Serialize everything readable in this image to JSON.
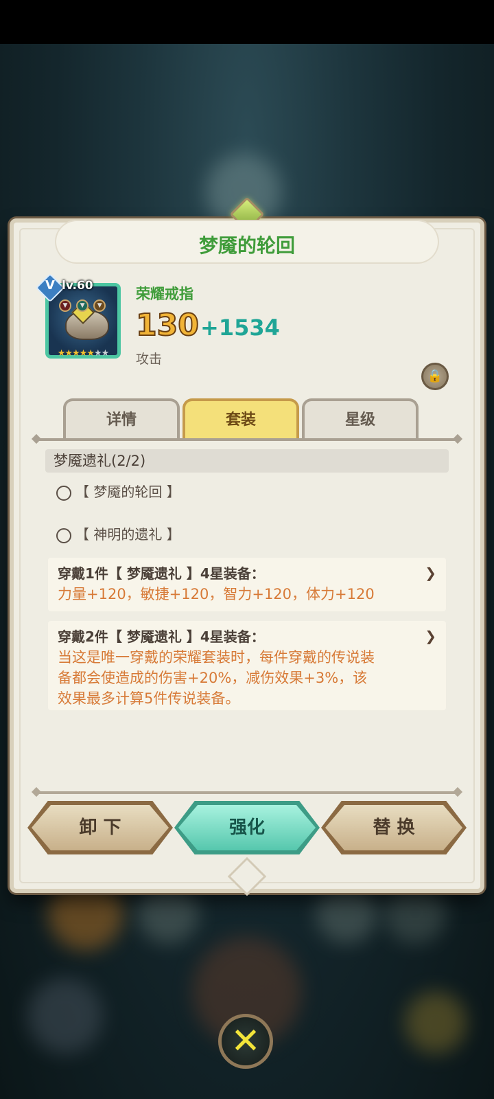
{
  "dialog": {
    "title": "梦魇的轮回",
    "item_name": "荣耀戒指",
    "level": "lv.60",
    "vip_badge": "V",
    "stars": [
      "on",
      "on",
      "on",
      "on",
      "on",
      "off",
      "off"
    ],
    "stat_base": "130",
    "stat_bonus": "+1534",
    "stat_label": "攻击",
    "lock_icon": "lock-icon"
  },
  "tabs": [
    {
      "label": "详情",
      "active": false
    },
    {
      "label": "套装",
      "active": true
    },
    {
      "label": "星级",
      "active": false
    }
  ],
  "set": {
    "header": "梦魇遗礼(2/2)",
    "pieces": [
      {
        "icon": "ring-icon",
        "label": "【 梦魇的轮回 】"
      },
      {
        "icon": "amulet-icon",
        "label": "【 神明的遗礼 】"
      }
    ],
    "bonuses": [
      {
        "title": "穿戴1件【 梦魇遗礼 】4星装备：",
        "lines": [
          "力量+120，敏捷+120，智力+120，体力+120"
        ]
      },
      {
        "title": "穿戴2件【 梦魇遗礼 】4星装备：",
        "lines": [
          "当这是唯一穿戴的荣耀套装时，每件穿戴的传说装",
          "备都会使造成的伤害+20%，减伤效果+3%，该",
          "效果最多计算5件传说装备。"
        ]
      }
    ]
  },
  "buttons": {
    "unequip": "卸 下",
    "enhance": "强化",
    "replace": "替 换"
  },
  "colors": {
    "title_green": "#3f9c3a",
    "bonus_orange": "#d77a37",
    "teal_accent": "#1fa596",
    "gold": "#f1b437"
  }
}
